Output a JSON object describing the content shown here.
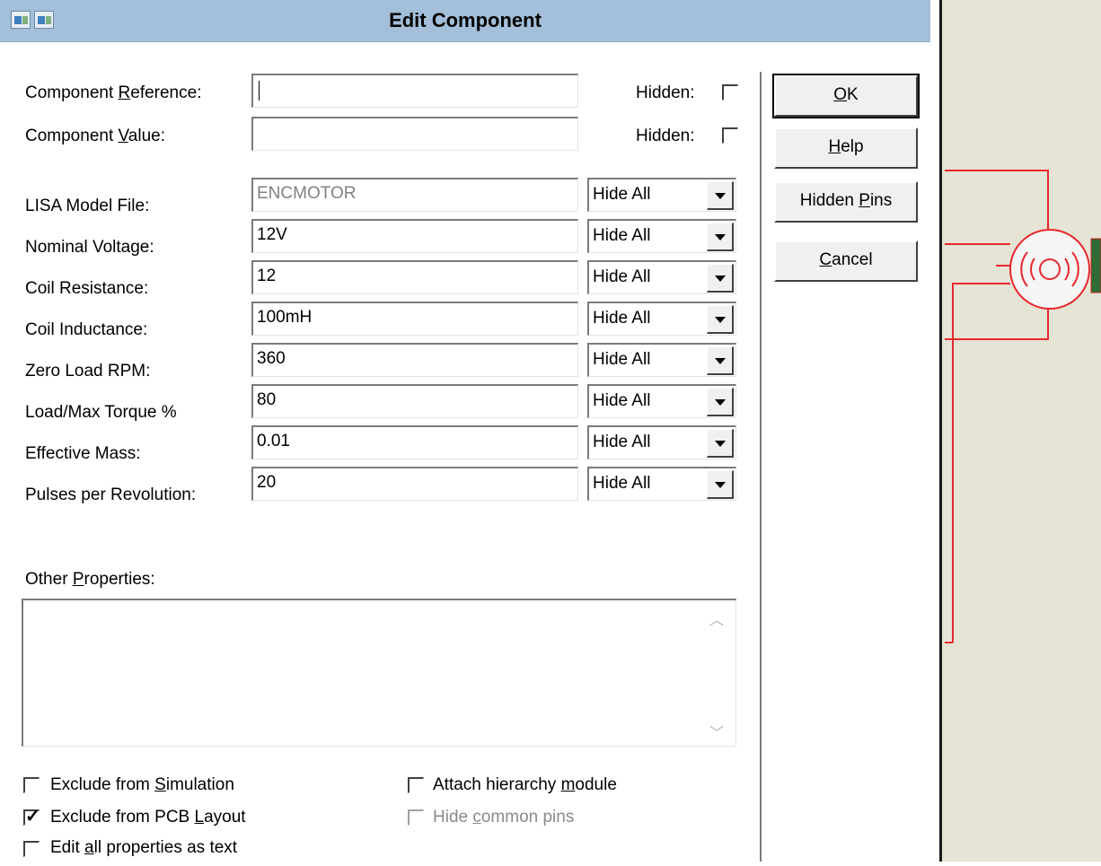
{
  "window": {
    "title": "Edit Component"
  },
  "fields": {
    "component_reference": {
      "label_pre": "Component ",
      "label_u": "R",
      "label_post": "eference:",
      "value": "",
      "hidden_label": "Hidden:"
    },
    "component_value": {
      "label_pre": "Component ",
      "label_u": "V",
      "label_post": "alue:",
      "value": "",
      "hidden_label": "Hidden:"
    }
  },
  "properties": [
    {
      "label": "LISA Model File:",
      "value": "ENCMOTOR",
      "visibility": "Hide All",
      "disabled": true
    },
    {
      "label": "Nominal Voltage:",
      "value": "12V",
      "visibility": "Hide All"
    },
    {
      "label": "Coil Resistance:",
      "value": "12",
      "visibility": "Hide All"
    },
    {
      "label": "Coil Inductance:",
      "value": "100mH",
      "visibility": "Hide All"
    },
    {
      "label": "Zero Load RPM:",
      "value": "360",
      "visibility": "Hide All"
    },
    {
      "label": "Load/Max Torque %",
      "value": "80",
      "visibility": "Hide All"
    },
    {
      "label": "Effective Mass:",
      "value": "0.01",
      "visibility": "Hide All"
    },
    {
      "label": "Pulses per Revolution:",
      "value": "20",
      "visibility": "Hide All"
    }
  ],
  "other_properties": {
    "label_pre": "Other ",
    "label_u": "P",
    "label_post": "roperties:",
    "text": ""
  },
  "buttons": {
    "ok": {
      "u": "O",
      "post": "K"
    },
    "help": {
      "u": "H",
      "post": "elp"
    },
    "hidden_pins": {
      "pre": "Hidden ",
      "u": "P",
      "post": "ins"
    },
    "cancel": {
      "u": "C",
      "post": "ancel"
    }
  },
  "checkboxes": {
    "exclude_sim": {
      "pre": "Exclude from ",
      "u": "S",
      "post": "imulation",
      "checked": false
    },
    "exclude_pcb": {
      "pre": "Exclude from PCB ",
      "u": "L",
      "post": "ayout",
      "checked": true
    },
    "edit_text": {
      "pre": "Edit ",
      "u": "a",
      "post": "ll properties as text",
      "checked": false
    },
    "attach_module": {
      "pre": "Attach hierarchy ",
      "u": "m",
      "post": "odule",
      "checked": false
    },
    "hide_common": {
      "pre": "Hide ",
      "u": "c",
      "post": "ommon pins",
      "checked": false,
      "disabled": true
    }
  },
  "colors": {
    "titlebar": "#a3bfd9",
    "wire": "#e8282d",
    "schematic_bg": "#e6e4d5"
  }
}
